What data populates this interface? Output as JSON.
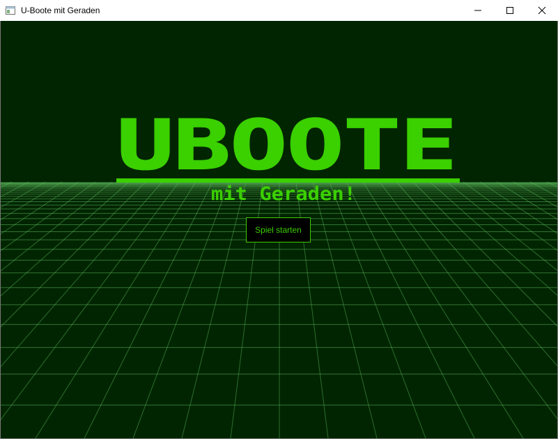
{
  "window": {
    "title": "U-Boote mit Geraden",
    "controls": [
      "minimize",
      "maximize",
      "close"
    ]
  },
  "game": {
    "logo_title": "UBOOTE",
    "logo_subtitle": "mit Geraden!",
    "start_button_label": "Spiel starten"
  },
  "icons": {
    "app": "app-window-icon",
    "minimize": "minimize-icon",
    "maximize": "maximize-icon",
    "close": "close-icon"
  },
  "colors": {
    "background": "#012501",
    "accent": "#3bd000",
    "grid": "#5cb85c",
    "button_bg": "#000000"
  }
}
